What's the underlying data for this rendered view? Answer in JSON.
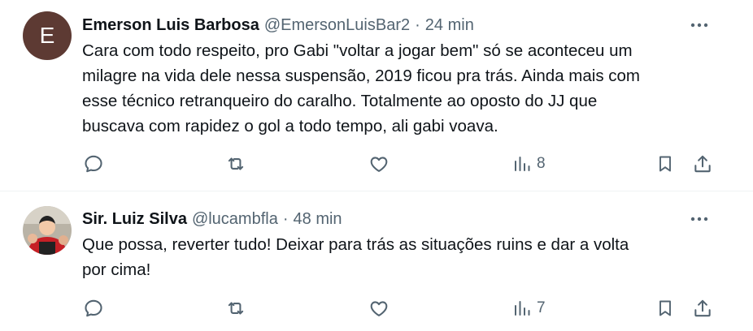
{
  "tweets": [
    {
      "avatar_letter": "E",
      "avatar_color": "#5d3a33",
      "name": "Emerson Luis Barbosa",
      "handle": "@EmersonLuisBar2",
      "separator": "·",
      "time": "24 min",
      "text": "Cara com todo respeito, pro Gabi \"voltar a jogar bem\" só se aconteceu um\nmilagre na vida dele nessa suspensão, 2019 ficou pra trás. Ainda mais com\nesse técnico retranqueiro do caralho. Totalmente ao oposto do JJ que\nbuscava com rapidez o gol a todo tempo, ali gabi voava.",
      "views": "8",
      "icons": [
        "reply-icon",
        "retweet-icon",
        "like-icon",
        "views-icon",
        "bookmark-icon",
        "share-icon",
        "more-icon"
      ]
    },
    {
      "avatar_colors": [
        "#c62026",
        "#222222",
        "#f2c9a8"
      ],
      "name": "Sir. Luiz Silva",
      "handle": "@lucambfla",
      "separator": "·",
      "time": "48 min",
      "text": "Que possa, reverter tudo! Deixar para trás as situações ruins e dar a volta\npor cima!",
      "views": "7",
      "icons": [
        "reply-icon",
        "retweet-icon",
        "like-icon",
        "views-icon",
        "bookmark-icon",
        "share-icon",
        "more-icon"
      ]
    }
  ],
  "colors": {
    "text": "#0f1419",
    "secondary": "#536471",
    "divider": "#eff3f4"
  }
}
